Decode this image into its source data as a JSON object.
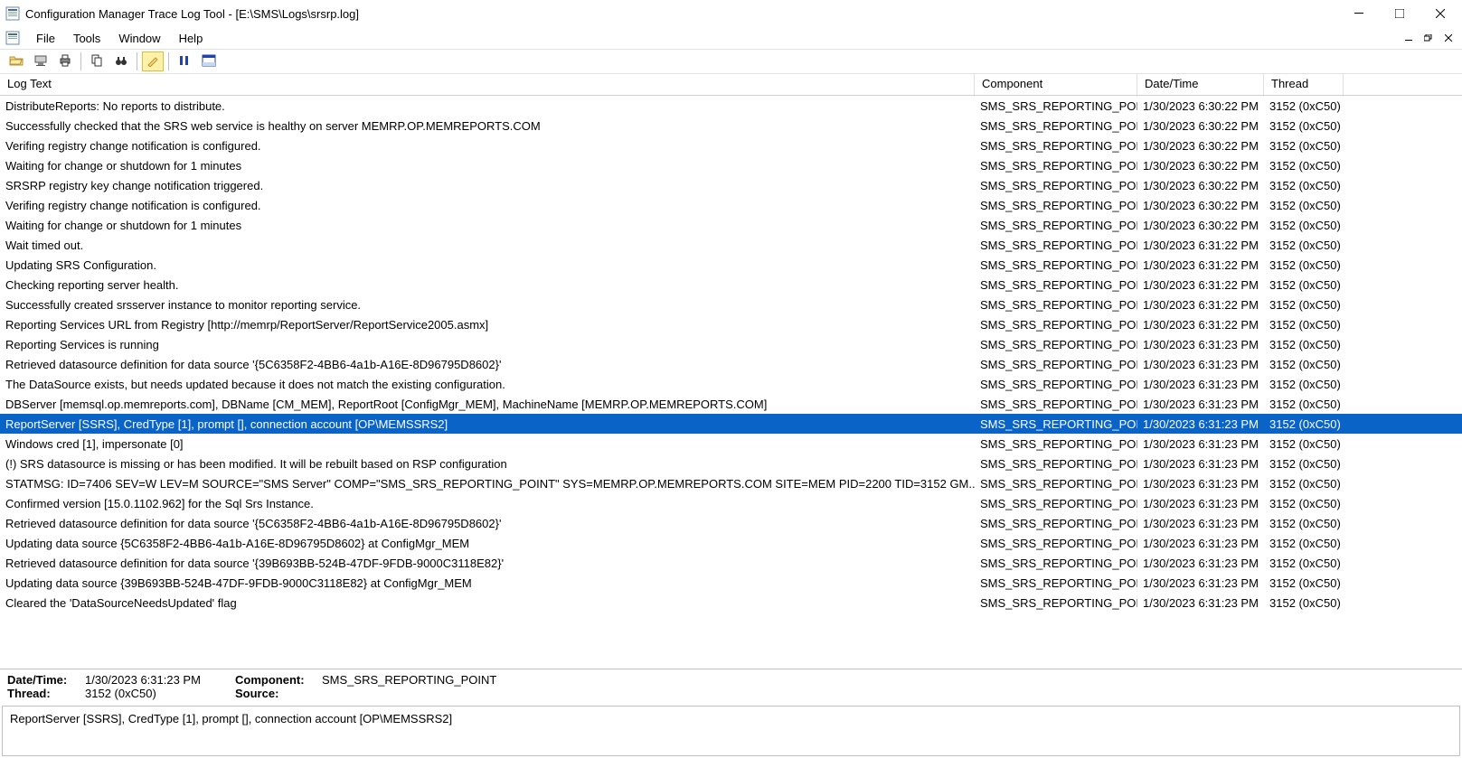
{
  "window": {
    "title": "Configuration Manager Trace Log Tool - [E:\\SMS\\Logs\\srsrp.log]"
  },
  "menu": {
    "file": "File",
    "tools": "Tools",
    "window": "Window",
    "help": "Help"
  },
  "columns": {
    "text": "Log Text",
    "component": "Component",
    "datetime": "Date/Time",
    "thread": "Thread"
  },
  "rows": [
    {
      "text": "DistributeReports: No reports to distribute.",
      "comp": "SMS_SRS_REPORTING_POIN",
      "dt": "1/30/2023 6:30:22 PM",
      "th": "3152 (0xC50)",
      "sel": false
    },
    {
      "text": "Successfully checked that the SRS web service is healthy on server MEMRP.OP.MEMREPORTS.COM",
      "comp": "SMS_SRS_REPORTING_POIN",
      "dt": "1/30/2023 6:30:22 PM",
      "th": "3152 (0xC50)",
      "sel": false
    },
    {
      "text": "Verifing registry change notification is configured.",
      "comp": "SMS_SRS_REPORTING_POIN",
      "dt": "1/30/2023 6:30:22 PM",
      "th": "3152 (0xC50)",
      "sel": false
    },
    {
      "text": "Waiting for change or shutdown for 1 minutes",
      "comp": "SMS_SRS_REPORTING_POIN",
      "dt": "1/30/2023 6:30:22 PM",
      "th": "3152 (0xC50)",
      "sel": false
    },
    {
      "text": "SRSRP registry key change notification triggered.",
      "comp": "SMS_SRS_REPORTING_POIN",
      "dt": "1/30/2023 6:30:22 PM",
      "th": "3152 (0xC50)",
      "sel": false
    },
    {
      "text": "Verifing registry change notification is configured.",
      "comp": "SMS_SRS_REPORTING_POIN",
      "dt": "1/30/2023 6:30:22 PM",
      "th": "3152 (0xC50)",
      "sel": false
    },
    {
      "text": "Waiting for change or shutdown for 1 minutes",
      "comp": "SMS_SRS_REPORTING_POIN",
      "dt": "1/30/2023 6:30:22 PM",
      "th": "3152 (0xC50)",
      "sel": false
    },
    {
      "text": "Wait timed out.",
      "comp": "SMS_SRS_REPORTING_POIN",
      "dt": "1/30/2023 6:31:22 PM",
      "th": "3152 (0xC50)",
      "sel": false
    },
    {
      "text": "Updating SRS Configuration.",
      "comp": "SMS_SRS_REPORTING_POIN",
      "dt": "1/30/2023 6:31:22 PM",
      "th": "3152 (0xC50)",
      "sel": false
    },
    {
      "text": "Checking reporting server health.",
      "comp": "SMS_SRS_REPORTING_POIN",
      "dt": "1/30/2023 6:31:22 PM",
      "th": "3152 (0xC50)",
      "sel": false
    },
    {
      "text": "Successfully created srsserver instance to monitor reporting service.",
      "comp": "SMS_SRS_REPORTING_POIN",
      "dt": "1/30/2023 6:31:22 PM",
      "th": "3152 (0xC50)",
      "sel": false
    },
    {
      "text": "Reporting Services URL from Registry [http://memrp/ReportServer/ReportService2005.asmx]",
      "comp": "SMS_SRS_REPORTING_POIN",
      "dt": "1/30/2023 6:31:22 PM",
      "th": "3152 (0xC50)",
      "sel": false
    },
    {
      "text": "Reporting Services is running",
      "comp": "SMS_SRS_REPORTING_POIN",
      "dt": "1/30/2023 6:31:23 PM",
      "th": "3152 (0xC50)",
      "sel": false
    },
    {
      "text": "Retrieved datasource definition for data source '{5C6358F2-4BB6-4a1b-A16E-8D96795D8602}'",
      "comp": "SMS_SRS_REPORTING_POIN",
      "dt": "1/30/2023 6:31:23 PM",
      "th": "3152 (0xC50)",
      "sel": false
    },
    {
      "text": "The DataSource exists, but needs updated because it does not match the existing configuration.",
      "comp": "SMS_SRS_REPORTING_POIN",
      "dt": "1/30/2023 6:31:23 PM",
      "th": "3152 (0xC50)",
      "sel": false
    },
    {
      "text": "DBServer [memsql.op.memreports.com], DBName [CM_MEM], ReportRoot [ConfigMgr_MEM], MachineName [MEMRP.OP.MEMREPORTS.COM]",
      "comp": "SMS_SRS_REPORTING_POIN",
      "dt": "1/30/2023 6:31:23 PM",
      "th": "3152 (0xC50)",
      "sel": false
    },
    {
      "text": "ReportServer [SSRS], CredType [1], prompt [], connection account [OP\\MEMSSRS2]",
      "comp": "SMS_SRS_REPORTING_POIN",
      "dt": "1/30/2023 6:31:23 PM",
      "th": "3152 (0xC50)",
      "sel": true
    },
    {
      "text": "Windows cred [1], impersonate [0]",
      "comp": "SMS_SRS_REPORTING_POIN",
      "dt": "1/30/2023 6:31:23 PM",
      "th": "3152 (0xC50)",
      "sel": false
    },
    {
      "text": "(!) SRS datasource is missing or has been modified.  It will be rebuilt based on RSP configuration",
      "comp": "SMS_SRS_REPORTING_POIN",
      "dt": "1/30/2023 6:31:23 PM",
      "th": "3152 (0xC50)",
      "sel": false
    },
    {
      "text": "STATMSG: ID=7406 SEV=W LEV=M SOURCE=\"SMS Server\" COMP=\"SMS_SRS_REPORTING_POINT\" SYS=MEMRP.OP.MEMREPORTS.COM SITE=MEM PID=2200 TID=3152 GM...",
      "comp": "SMS_SRS_REPORTING_POIN",
      "dt": "1/30/2023 6:31:23 PM",
      "th": "3152 (0xC50)",
      "sel": false
    },
    {
      "text": "Confirmed version [15.0.1102.962] for the Sql Srs Instance.",
      "comp": "SMS_SRS_REPORTING_POIN",
      "dt": "1/30/2023 6:31:23 PM",
      "th": "3152 (0xC50)",
      "sel": false
    },
    {
      "text": "Retrieved datasource definition for data source '{5C6358F2-4BB6-4a1b-A16E-8D96795D8602}'",
      "comp": "SMS_SRS_REPORTING_POIN",
      "dt": "1/30/2023 6:31:23 PM",
      "th": "3152 (0xC50)",
      "sel": false
    },
    {
      "text": "Updating data source {5C6358F2-4BB6-4a1b-A16E-8D96795D8602} at ConfigMgr_MEM",
      "comp": "SMS_SRS_REPORTING_POIN",
      "dt": "1/30/2023 6:31:23 PM",
      "th": "3152 (0xC50)",
      "sel": false
    },
    {
      "text": "Retrieved datasource definition for data source '{39B693BB-524B-47DF-9FDB-9000C3118E82}'",
      "comp": "SMS_SRS_REPORTING_POIN",
      "dt": "1/30/2023 6:31:23 PM",
      "th": "3152 (0xC50)",
      "sel": false
    },
    {
      "text": "Updating data source {39B693BB-524B-47DF-9FDB-9000C3118E82} at ConfigMgr_MEM",
      "comp": "SMS_SRS_REPORTING_POIN",
      "dt": "1/30/2023 6:31:23 PM",
      "th": "3152 (0xC50)",
      "sel": false
    },
    {
      "text": "Cleared the 'DataSourceNeedsUpdated' flag",
      "comp": "SMS_SRS_REPORTING_POIN",
      "dt": "1/30/2023 6:31:23 PM",
      "th": "3152 (0xC50)",
      "sel": false
    }
  ],
  "detail": {
    "datetime_label": "Date/Time:",
    "datetime_value": "1/30/2023 6:31:23 PM",
    "component_label": "Component:",
    "component_value": "SMS_SRS_REPORTING_POINT",
    "thread_label": "Thread:",
    "thread_value": "3152 (0xC50)",
    "source_label": "Source:",
    "source_value": ""
  },
  "message_text": "ReportServer [SSRS], CredType [1], prompt [], connection account [OP\\MEMSSRS2]"
}
